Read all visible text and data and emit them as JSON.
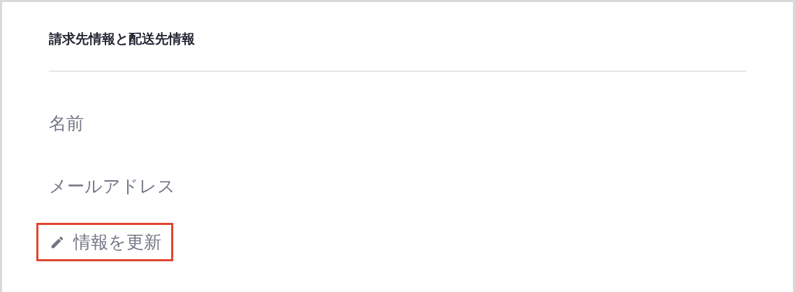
{
  "card": {
    "title": "請求先情報と配送先情報",
    "fields": [
      {
        "label": "名前"
      },
      {
        "label": "メールアドレス"
      }
    ],
    "update_button": {
      "label": "情報を更新",
      "highlighted": true
    }
  }
}
